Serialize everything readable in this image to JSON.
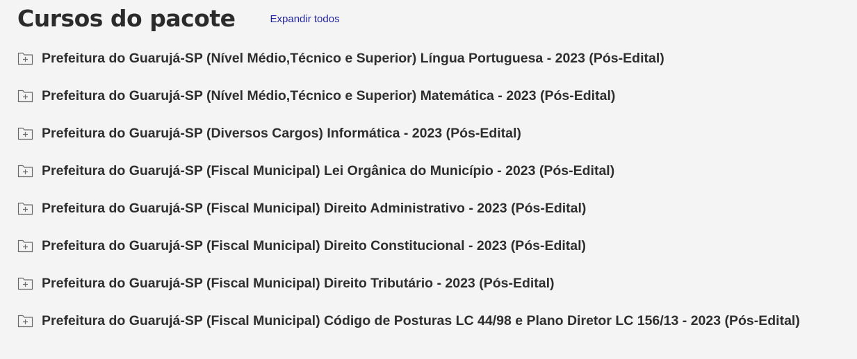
{
  "header": {
    "title": "Cursos do pacote",
    "expand_all_label": "Expandir todos"
  },
  "colors": {
    "background": "#f4f4f5",
    "link": "#2426a0",
    "text": "#2e2e2e"
  },
  "courses": [
    {
      "label": "Prefeitura do Guarujá-SP (Nível Médio,Técnico e Superior) Língua Portuguesa - 2023 (Pós-Edital)",
      "icon": "folder-plus-icon"
    },
    {
      "label": "Prefeitura do Guarujá-SP (Nível Médio,Técnico e Superior) Matemática - 2023 (Pós-Edital)",
      "icon": "folder-plus-icon"
    },
    {
      "label": "Prefeitura do Guarujá-SP (Diversos Cargos) Informática - 2023 (Pós-Edital)",
      "icon": "folder-plus-icon"
    },
    {
      "label": "Prefeitura do Guarujá-SP (Fiscal Municipal) Lei Orgânica do Município - 2023 (Pós-Edital)",
      "icon": "folder-plus-icon"
    },
    {
      "label": "Prefeitura do Guarujá-SP (Fiscal Municipal) Direito Administrativo - 2023 (Pós-Edital)",
      "icon": "folder-plus-icon"
    },
    {
      "label": "Prefeitura do Guarujá-SP (Fiscal Municipal) Direito Constitucional - 2023 (Pós-Edital)",
      "icon": "folder-plus-icon"
    },
    {
      "label": "Prefeitura do Guarujá-SP (Fiscal Municipal) Direito Tributário - 2023 (Pós-Edital)",
      "icon": "folder-plus-icon"
    },
    {
      "label": "Prefeitura do Guarujá-SP (Fiscal Municipal) Código de Posturas LC 44/98 e Plano Diretor LC 156/13 - 2023 (Pós-Edital)",
      "icon": "folder-plus-icon"
    }
  ]
}
